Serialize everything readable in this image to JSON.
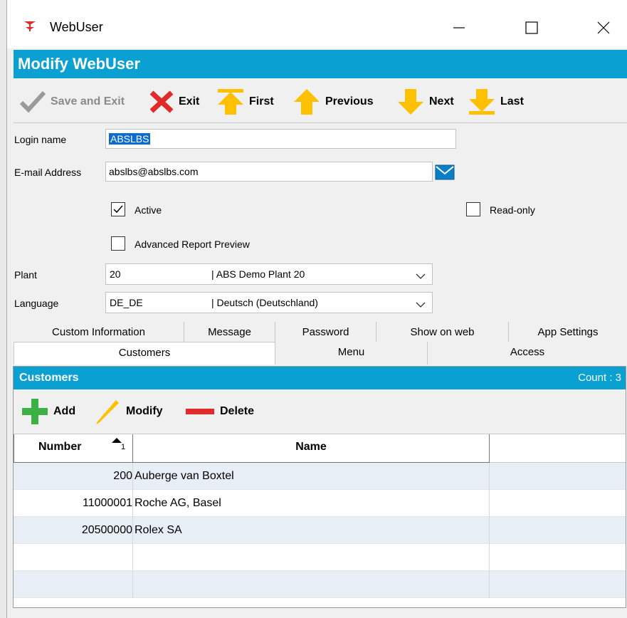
{
  "window": {
    "title": "WebUser"
  },
  "header": {
    "title": "Modify WebUser"
  },
  "toolbar": {
    "save_exit": "Save and Exit",
    "exit": "Exit",
    "first": "First",
    "previous": "Previous",
    "next": "Next",
    "last": "Last"
  },
  "form": {
    "login_label": "Login name",
    "login_value": "ABSLBS",
    "email_label": "E-mail Address",
    "email_value": "abslbs@abslbs.com",
    "active_label": "Active",
    "active_checked": true,
    "readonly_label": "Read-only",
    "readonly_checked": false,
    "adv_report_label": "Advanced Report Preview",
    "adv_report_checked": false,
    "plant_label": "Plant",
    "plant_code": "20",
    "plant_desc": "| ABS Demo Plant 20",
    "language_label": "Language",
    "language_code": "DE_DE",
    "language_desc": "| Deutsch (Deutschland)"
  },
  "tabs_row1": [
    "Custom Information",
    "Message",
    "Password",
    "Show on web",
    "App Settings"
  ],
  "tabs_row2": [
    "Customers",
    "Menu",
    "Access"
  ],
  "customers": {
    "title": "Customers",
    "count": "Count : 3",
    "add": "Add",
    "modify": "Modify",
    "delete": "Delete",
    "columns": [
      "Number",
      "Name"
    ],
    "sort_indicator": "1",
    "rows": [
      {
        "number": "200",
        "name": "Auberge van Boxtel"
      },
      {
        "number": "11000001",
        "name": "Roche AG, Basel"
      },
      {
        "number": "20500000",
        "name": "Rolex SA"
      }
    ]
  },
  "colors": {
    "accent": "#0aa0d1",
    "arrow": "#ffc000",
    "exit": "#e12b2b",
    "add": "#3cb043"
  }
}
